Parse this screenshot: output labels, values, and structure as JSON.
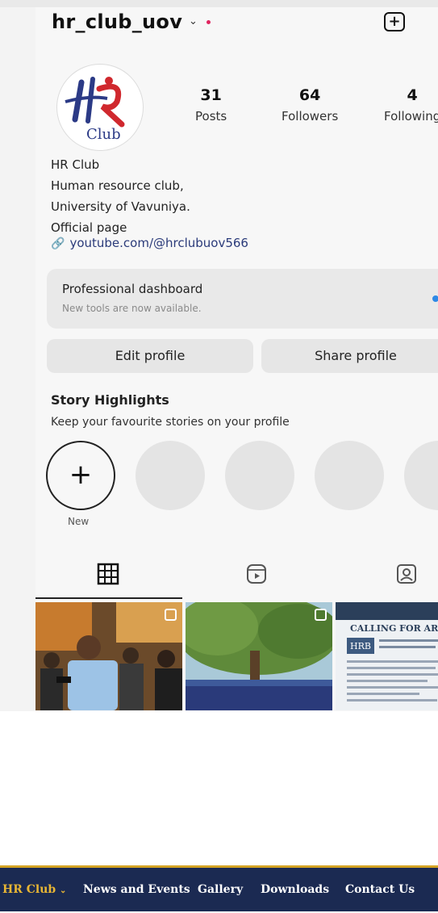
{
  "profile": {
    "username": "hr_club_uov",
    "avatar_text": "Club",
    "stats": [
      {
        "value": "31",
        "label": "Posts"
      },
      {
        "value": "64",
        "label": "Followers"
      },
      {
        "value": "4",
        "label": "Following"
      }
    ],
    "bio_lines": [
      "HR Club",
      "Human resource club,",
      "University of Vavuniya.",
      "Official page"
    ],
    "link": "youtube.com/@hrclubuov566"
  },
  "dashboard": {
    "title": "Professional dashboard",
    "subtitle": "New tools are now available."
  },
  "buttons": {
    "edit": "Edit profile",
    "share": "Share profile"
  },
  "highlights": {
    "title": "Story Highlights",
    "subtitle": "Keep your favourite stories on your profile",
    "new_label": "New"
  },
  "posts": {
    "third_heading": "CALLING FOR ART",
    "third_logo": "HRB"
  },
  "site_nav": {
    "items": [
      "HR Club",
      "News and Events",
      "Gallery",
      "Downloads",
      "Contact Us"
    ],
    "active_chevron": "⌄"
  },
  "colors": {
    "nav_bg": "#1b2a52",
    "nav_accent": "#e7b534"
  }
}
